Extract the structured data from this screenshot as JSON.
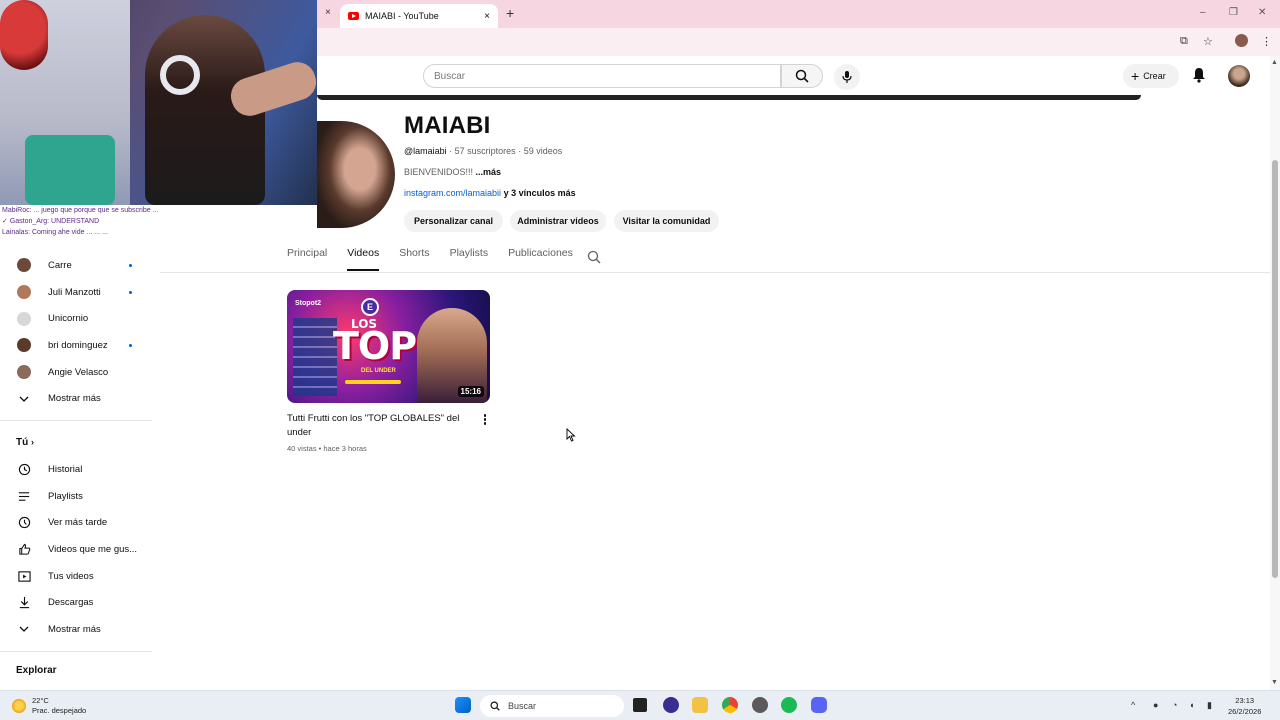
{
  "browser": {
    "tab_title": "MAIABI - YouTube",
    "new_tab": "+",
    "close": "×",
    "window_min": "–",
    "window_max": "❐",
    "window_close": "✕"
  },
  "masthead": {
    "search_placeholder": "Buscar",
    "create_label": "Crear"
  },
  "webcam": {
    "chat_lines": [
      "MabiRoc: ... juego que porque que se subscribe ...",
      "✓ Gaston_Arg: UNDERSTAND",
      "Lainalas: Coming ahe vide ... ... ..."
    ]
  },
  "sidebar": {
    "subscriptions": [
      {
        "name": "Carre",
        "color": "#6b4a3a",
        "live": true
      },
      {
        "name": "Juli Manzotti",
        "color": "#b07a5a",
        "live": true
      },
      {
        "name": "Unicornio",
        "color": "#d8d8d8",
        "live": false
      },
      {
        "name": "bri dominguez",
        "color": "#5a3a2a",
        "live": true
      },
      {
        "name": "Angie Velasco",
        "color": "#8a6a5a",
        "live": false
      }
    ],
    "show_more_1": "Mostrar más",
    "you_section": "Tú",
    "you_items": [
      {
        "label": "Historial",
        "icon": "history-icon"
      },
      {
        "label": "Playlists",
        "icon": "playlists-icon"
      },
      {
        "label": "Ver más tarde",
        "icon": "watch-later-icon"
      },
      {
        "label": "Videos que me gus...",
        "icon": "like-icon"
      },
      {
        "label": "Tus videos",
        "icon": "your-videos-icon"
      },
      {
        "label": "Descargas",
        "icon": "download-icon"
      }
    ],
    "show_more_2": "Mostrar más",
    "explore_section": "Explorar"
  },
  "channel": {
    "name": "MAIABI",
    "handle": "@lamaiabi",
    "subscribers": "57 suscriptores",
    "videos_count": "59 videos",
    "separator": " · ",
    "description": "BIENVENIDOS!!!",
    "desc_more": "...más",
    "link": "instagram.com/lamaiabii",
    "more_links": "y 3 vínculos más",
    "buttons": [
      "Personalizar canal",
      "Administrar videos",
      "Visitar la comunidad"
    ],
    "tabs": [
      "Principal",
      "Videos",
      "Shorts",
      "Playlists",
      "Publicaciones"
    ],
    "active_tab": "Videos"
  },
  "videos": [
    {
      "title": "Tutti Frutti con los \"TOP GLOBALES\" del under",
      "meta": "40 vistas • hace 3 horas",
      "duration": "15:16",
      "thumb_text": {
        "brand": "Stopot2",
        "logo": "E",
        "los": "LOS",
        "top": "TOP",
        "under": "DEL UNDER"
      }
    }
  ],
  "taskbar": {
    "temperature": "22°C",
    "weather": "Prac. despejado",
    "search": "Buscar",
    "time": "23:13",
    "date": "26/2/2026"
  },
  "colors": {
    "accent_link": "#065fd4",
    "tabstrip": "#f6d6e0",
    "youtube_red": "#ff0000"
  }
}
